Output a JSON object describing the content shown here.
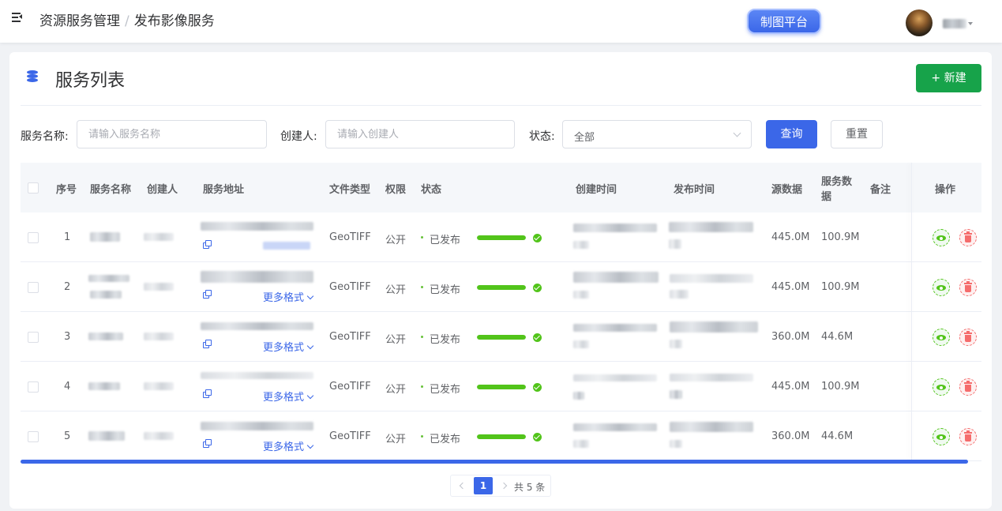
{
  "header": {
    "breadcrumb": [
      "资源服务管理",
      "发布影像服务"
    ],
    "separator": "/",
    "platform_button": "制图平台"
  },
  "card": {
    "title": "服务列表",
    "new_button": "+ 新建"
  },
  "filters": {
    "name_label": "服务名称:",
    "name_placeholder": "请输入服务名称",
    "creator_label": "创建人:",
    "creator_placeholder": "请输入创建人",
    "status_label": "状态:",
    "status_value": "全部",
    "query_button": "查询",
    "reset_button": "重置"
  },
  "table": {
    "columns": {
      "index": "序号",
      "name": "服务名称",
      "creator": "创建人",
      "address": "服务地址",
      "file_type": "文件类型",
      "permission": "权限",
      "status": "状态",
      "created": "创建时间",
      "published": "发布时间",
      "source_data": "源数据",
      "service_data_1": "服务数",
      "service_data_2": "据",
      "remark": "备注",
      "actions": "操作"
    },
    "more_formats": "更多格式",
    "rows": [
      {
        "index": "1",
        "file_type": "GeoTIFF",
        "permission": "公开",
        "status": "已发布",
        "progress": 1.0,
        "source": "445.0M",
        "service": "100.9M"
      },
      {
        "index": "2",
        "file_type": "GeoTIFF",
        "permission": "公开",
        "status": "已发布",
        "progress": 1.0,
        "source": "445.0M",
        "service": "100.9M"
      },
      {
        "index": "3",
        "file_type": "GeoTIFF",
        "permission": "公开",
        "status": "已发布",
        "progress": 1.0,
        "source": "360.0M",
        "service": "44.6M"
      },
      {
        "index": "4",
        "file_type": "GeoTIFF",
        "permission": "公开",
        "status": "已发布",
        "progress": 1.0,
        "source": "445.0M",
        "service": "100.9M"
      },
      {
        "index": "5",
        "file_type": "GeoTIFF",
        "permission": "公开",
        "status": "已发布",
        "progress": 1.0,
        "source": "360.0M",
        "service": "44.6M"
      }
    ]
  },
  "pagination": {
    "current": "1",
    "total": "共 5 条"
  },
  "icons": [
    "menu-fold-icon",
    "database-icon",
    "copy-icon",
    "check-circle-icon",
    "eye-icon",
    "trash-icon",
    "chevron-down-icon",
    "chevron-left-icon",
    "chevron-right-icon"
  ],
  "colors": {
    "primary": "#3b67e8",
    "success": "#17a34a",
    "danger": "#f56c6c",
    "progress": "#52c41a"
  }
}
